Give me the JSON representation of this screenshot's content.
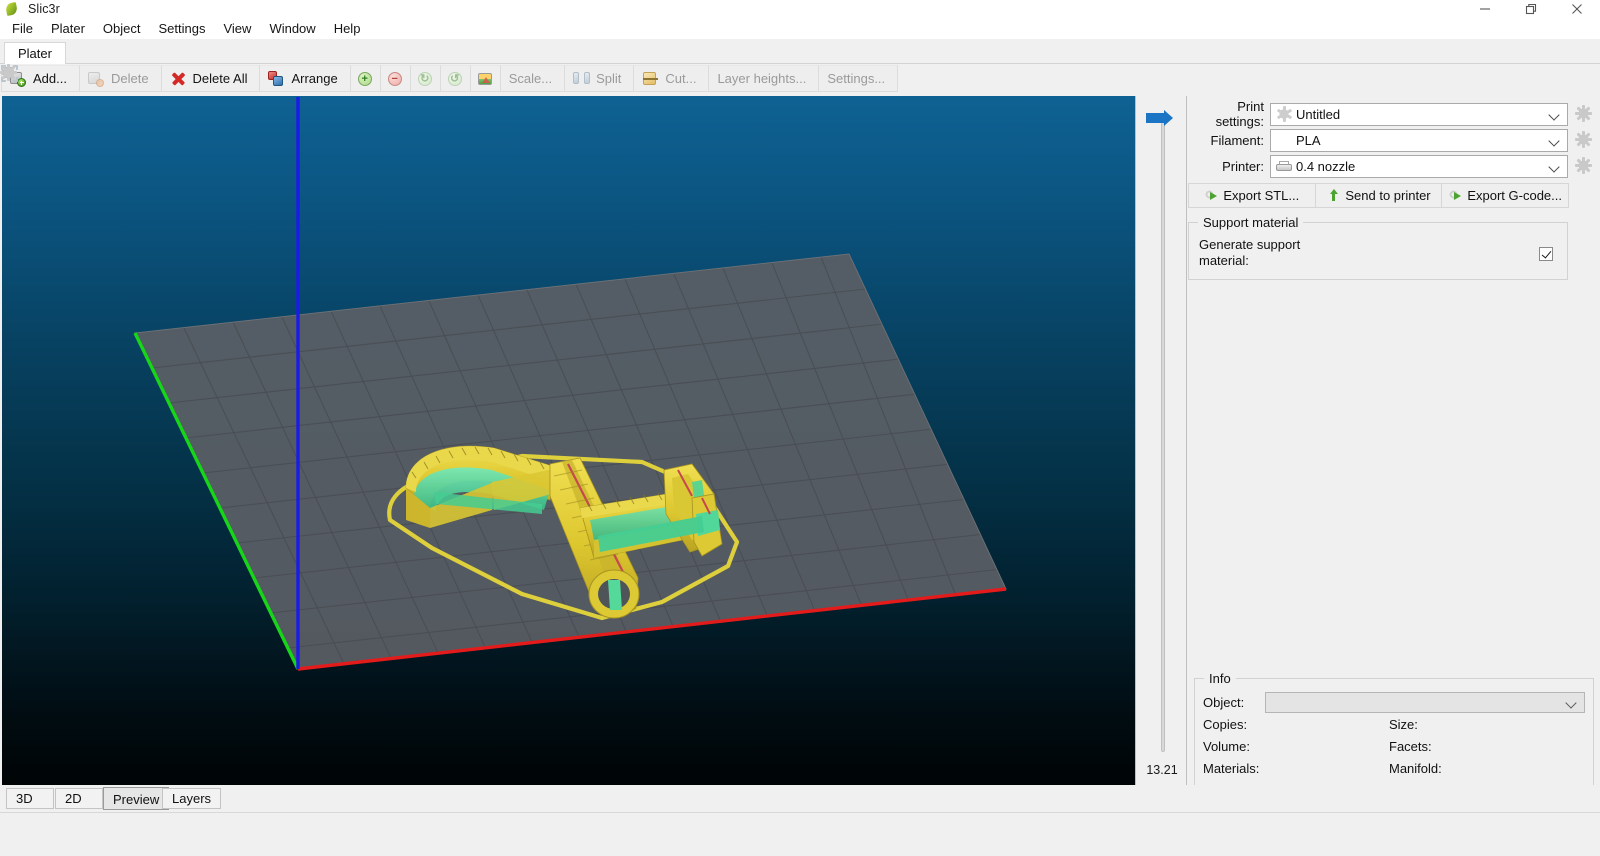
{
  "window": {
    "title": "Slic3r",
    "app_icon": "leaf-icon",
    "controls": [
      {
        "name": "minimize",
        "glyph": "minimize-icon"
      },
      {
        "name": "maximize",
        "glyph": "restore-icon"
      },
      {
        "name": "close",
        "glyph": "close-icon"
      }
    ]
  },
  "menubar": {
    "items": [
      "File",
      "Plater",
      "Object",
      "Settings",
      "View",
      "Window",
      "Help"
    ]
  },
  "tabs": {
    "active": "Plater",
    "items": [
      "Plater"
    ]
  },
  "toolbar": {
    "buttons": [
      {
        "label": "Add...",
        "icon": "add-object-icon",
        "enabled": true
      },
      {
        "label": "Delete",
        "icon": "delete-object-icon",
        "enabled": false
      },
      {
        "label": "Delete All",
        "icon": "delete-all-icon",
        "enabled": true
      },
      {
        "label": "Arrange",
        "icon": "arrange-icon",
        "enabled": true
      },
      {
        "label": "",
        "icon": "increase-copies-icon",
        "enabled": true
      },
      {
        "label": "",
        "icon": "decrease-copies-icon",
        "enabled": true
      },
      {
        "label": "",
        "icon": "rotate-cw-icon",
        "enabled": false
      },
      {
        "label": "",
        "icon": "rotate-ccw-icon",
        "enabled": false
      },
      {
        "label": "",
        "icon": "place-on-face-icon",
        "enabled": true
      },
      {
        "label": "Scale...",
        "icon": "scale-icon",
        "enabled": false
      },
      {
        "label": "Split",
        "icon": "split-icon",
        "enabled": false
      },
      {
        "label": "Cut...",
        "icon": "cut-icon",
        "enabled": false
      },
      {
        "label": "Layer heights...",
        "icon": "layer-heights-icon",
        "enabled": false
      },
      {
        "label": "Settings...",
        "icon": "settings-gear-icon",
        "enabled": false
      }
    ]
  },
  "viewport": {
    "background_top": "#0e6293",
    "background_bottom": "#000405",
    "bed_color": "#5d6268",
    "grid_color": "#4a4f55",
    "axis_x_color": "#e02020",
    "axis_y_color": "#16d416",
    "axis_z_color": "#1414e0",
    "extrusion_perimeter_color": "#e8d43b",
    "extrusion_infill_color": "#4bd99a",
    "extrusion_internal_color": "#d04a5a"
  },
  "layer_slider": {
    "value": "13.21",
    "handle": "layer-slider-handle",
    "handle_color": "#1b74c4"
  },
  "settings": {
    "print_settings": {
      "label": "Print settings:",
      "value": "Untitled",
      "icon": "gear-icon"
    },
    "filament": {
      "label": "Filament:",
      "value": "PLA",
      "icon": ""
    },
    "printer": {
      "label": "Printer:",
      "value": "0.4 nozzle",
      "icon": "printer-icon"
    },
    "config_button_icon": "gear-icon"
  },
  "actions": {
    "export_stl": {
      "label": "Export STL...",
      "icon": "export-icon"
    },
    "send_to_printer": {
      "label": "Send to printer",
      "icon": "upload-arrow-icon"
    },
    "export_gcode": {
      "label": "Export G-code...",
      "icon": "export-icon"
    }
  },
  "support_material": {
    "title": "Support material",
    "generate_label_line1": "Generate support",
    "generate_label_line2": "material:",
    "generate_checked": true
  },
  "info": {
    "title": "Info",
    "object_label": "Object:",
    "object_value": "",
    "fields": [
      {
        "left_label": "Copies:",
        "left_value": "",
        "right_label": "Size:",
        "right_value": ""
      },
      {
        "left_label": "Volume:",
        "left_value": "",
        "right_label": "Facets:",
        "right_value": ""
      },
      {
        "left_label": "Materials:",
        "left_value": "",
        "right_label": "Manifold:",
        "right_value": ""
      }
    ]
  },
  "view_tabs": {
    "active": "Preview",
    "items": [
      "3D",
      "2D",
      "Preview",
      "Layers"
    ]
  },
  "statusbar": {
    "text": ""
  }
}
